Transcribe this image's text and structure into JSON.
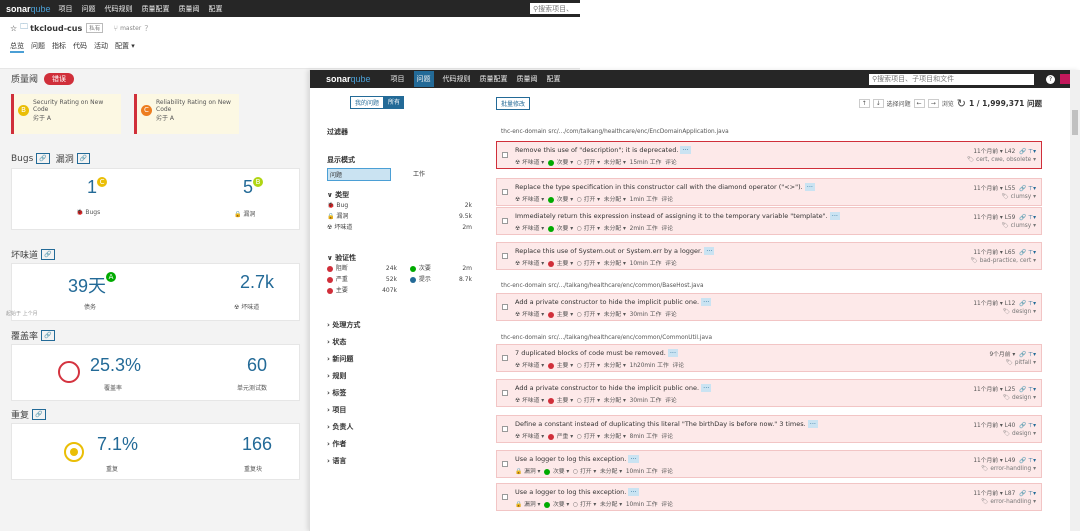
{
  "left": {
    "nav": {
      "logo_a": "sonar",
      "logo_b": "qube",
      "items": [
        "项目",
        "问题",
        "代码规则",
        "质量配置",
        "质量阈",
        "配置"
      ],
      "search": "搜索项目、"
    },
    "project": {
      "name": "tkcloud-cus",
      "badge": "私有",
      "branch": "master"
    },
    "tabs": [
      "总览",
      "问题",
      "指标",
      "代码",
      "活动",
      "配置 ▾"
    ],
    "gate": {
      "title": "质量阈",
      "status": "错误",
      "cond1": {
        "grade": "B",
        "text": "Security Rating on New Code",
        "detail": "劣于 A"
      },
      "cond2": {
        "grade": "C",
        "text": "Reliability Rating on New Code",
        "detail": "劣于 A"
      }
    },
    "bugs": {
      "title": "Bugs",
      "title2": "漏洞",
      "bug_val": "1",
      "bug_grade": "C",
      "bug_label": "Bugs",
      "vuln_val": "5",
      "vuln_grade": "B",
      "vuln_label": "漏洞"
    },
    "smell": {
      "title": "坏味道",
      "debt_val": "39天",
      "debt_grade": "A",
      "debt_label": "债务",
      "smell_val": "2.7k",
      "smell_label": "坏味道",
      "since": "起始于 上个月"
    },
    "cov": {
      "title": "覆盖率",
      "val": "25.3%",
      "label": "覆盖率",
      "tests_val": "60",
      "tests_label": "单元测试数"
    },
    "dup": {
      "title": "重复",
      "val": "7.1%",
      "label": "重复",
      "blocks_val": "166",
      "blocks_label": "重复块"
    }
  },
  "right": {
    "nav": {
      "items": [
        "项目",
        "问题",
        "代码规则",
        "质量配置",
        "质量阈",
        "配置"
      ],
      "search": "搜索项目、子项目和文件"
    },
    "my": "我的问题",
    "all": "所有",
    "filters": "过滤器",
    "mode_title": "显示模式",
    "mode_issues": "问题",
    "mode_effort": "工作",
    "type_title": "类型",
    "types": [
      {
        "n": "Bug",
        "v": "2k"
      },
      {
        "n": "漏洞",
        "v": "9.5k"
      },
      {
        "n": "坏味道",
        "v": "2m"
      }
    ],
    "sev_title": "验证性",
    "sev": [
      {
        "n": "阻断",
        "v": "24k",
        "n2": "次要",
        "v2": "2m"
      },
      {
        "n": "严重",
        "v": "52k",
        "n2": "提示",
        "v2": "8.7k"
      },
      {
        "n": "主要",
        "v": "407k",
        "n2": "",
        "v2": ""
      }
    ],
    "more": [
      "处理方式",
      "状态",
      "新问题",
      "规则",
      "标签",
      "项目",
      "负责人",
      "作者",
      "语言"
    ],
    "bulk": "批量修改",
    "select_hint": "选择问题",
    "browse": "浏览",
    "count": "1 / 1,999,371 问题",
    "comps": [
      "thc-enc-domain  src/.../com/taikang/healthcare/enc/EncDomainApplication.java",
      "thc-enc-domain  src/.../taikang/healthcare/enc/common/BaseHost.java",
      "thc-enc-domain  src/.../taikang/healthcare/enc/common/CommonUtil.java"
    ],
    "issues": [
      {
        "msg": "Remove this use of \"description\"; it is deprecated.",
        "type": "坏味道",
        "sev": "次要",
        "eff": "15min 工作",
        "time": "11个月前 ▾  L42",
        "tags": "cert, cwe, obsolete ▾"
      },
      {
        "msg": "Replace the type specification in this constructor call with the diamond operator (\"<>\").",
        "type": "坏味道",
        "sev": "次要",
        "eff": "1min 工作",
        "time": "11个月前 ▾  L55",
        "tags": "clumsy ▾"
      },
      {
        "msg": "Immediately return this expression instead of assigning it to the temporary variable \"template\".",
        "type": "坏味道",
        "sev": "次要",
        "eff": "2min 工作",
        "time": "11个月前 ▾  L59",
        "tags": "clumsy ▾"
      },
      {
        "msg": "Replace this use of System.out or System.err by a logger.",
        "type": "坏味道",
        "sev": "主要",
        "eff": "10min 工作",
        "time": "11个月前 ▾  L65",
        "tags": "bad-practice, cert ▾"
      },
      {
        "msg": "Add a private constructor to hide the implicit public one.",
        "type": "坏味道",
        "sev": "主要",
        "eff": "30min 工作",
        "time": "11个月前 ▾  L12",
        "tags": "design ▾"
      },
      {
        "msg": "7 duplicated blocks of code must be removed.",
        "type": "坏味道",
        "sev": "主要",
        "eff": "1h20min 工作",
        "time": "9个月前 ▾",
        "tags": "pitfall ▾"
      },
      {
        "msg": "Add a private constructor to hide the implicit public one.",
        "type": "坏味道",
        "sev": "主要",
        "eff": "30min 工作",
        "time": "11个月前 ▾  L25",
        "tags": "design ▾"
      },
      {
        "msg": "Define a constant instead of duplicating this literal \"The birthDay is before now.\" 3 times.",
        "type": "坏味道",
        "sev": "严重",
        "eff": "8min 工作",
        "time": "11个月前 ▾  L40",
        "tags": "design ▾"
      },
      {
        "msg": "Use a logger to log this exception.",
        "type": "漏洞",
        "sev": "次要",
        "eff": "10min 工作",
        "time": "11个月前 ▾  L49",
        "tags": "error-handling ▾"
      },
      {
        "msg": "Use a logger to log this exception.",
        "type": "漏洞",
        "sev": "次要",
        "eff": "10min 工作",
        "time": "11个月前 ▾  L87",
        "tags": "error-handling ▾"
      }
    ],
    "status": "打开",
    "assign": "未分配",
    "comment": "评论"
  }
}
